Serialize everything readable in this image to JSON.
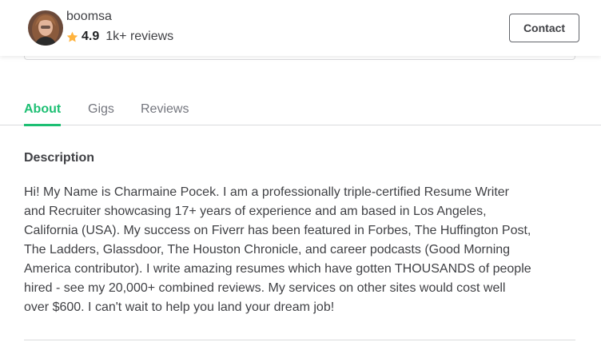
{
  "seller": {
    "name": "boomsa",
    "rating": "4.9",
    "review_count": "1k+ reviews",
    "star_color": "#ffb33e",
    "avatar_icon": "profile-photo"
  },
  "header": {
    "contact_label": "Contact"
  },
  "tabs": [
    {
      "label": "About",
      "active": true
    },
    {
      "label": "Gigs",
      "active": false
    },
    {
      "label": "Reviews",
      "active": false
    }
  ],
  "description": {
    "title": "Description",
    "lines": [
      "Hi! My Name is Charmaine Pocek. I am a professionally triple-certified Resume Writer",
      "and Recruiter showcasing 17+ years of experience and am based in Los Angeles,",
      "California (USA). My success on Fiverr has been featured in Forbes, The Huffington Post,",
      "The Ladders, Glassdoor, The Houston Chronicle, and career podcasts (Good Morning",
      "America contributor). I write amazing resumes which have gotten THOUSANDS of people",
      "hired - see my 20,000+ combined reviews. My services on other sites would cost well",
      "over $600. I can't wait to help you land your dream job!"
    ]
  },
  "colors": {
    "accent": "#1dbf73",
    "text": "#404145",
    "muted": "#74767e",
    "border": "#dadbdd"
  }
}
